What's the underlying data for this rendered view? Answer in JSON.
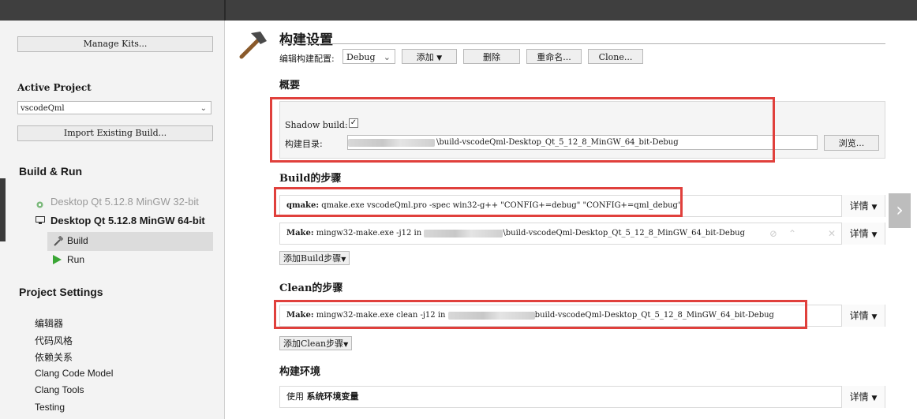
{
  "sidebar": {
    "manage_kits": "Manage Kits...",
    "active_project_label": "Active Project",
    "project_selected": "vscodeQml",
    "import_build": "Import Existing Build...",
    "build_run_label": "Build & Run",
    "kits": [
      {
        "label": "Desktop Qt 5.12.8 MinGW 32-bit"
      },
      {
        "label": "Desktop Qt 5.12.8 MinGW 64-bit"
      }
    ],
    "build_item": "Build",
    "run_item": "Run",
    "project_settings_label": "Project Settings",
    "settings_items": [
      "编辑器",
      "代码风格",
      "依赖关系",
      "Clang Code Model",
      "Clang Tools",
      "Testing"
    ]
  },
  "main": {
    "title": "构建设置",
    "edit_config_label": "编辑构建配置:",
    "config_selected": "Debug",
    "add_button": "添加",
    "delete_button": "删除",
    "rename_button": "重命名...",
    "clone_button": "Clone...",
    "overview_heading": "概要",
    "shadow_build_label": "Shadow build:",
    "build_dir_label": "构建目录:",
    "build_dir_value": "\\build-vscodeQml-Desktop_Qt_5_12_8_MinGW_64_bit-Debug",
    "browse_button": "浏览...",
    "build_steps_heading": "Build的步骤",
    "build_steps": [
      {
        "name": "qmake:",
        "command": "qmake.exe vscodeQml.pro -spec win32-g++ \"CONFIG+=debug\" \"CONFIG+=qml_debug\"",
        "details": "详情"
      },
      {
        "name": "Make:",
        "command": "mingw32-make.exe -j12 in",
        "path": "\\build-vscodeQml-Desktop_Qt_5_12_8_MinGW_64_bit-Debug",
        "details": "详情"
      }
    ],
    "add_build_step": "添加Build步骤",
    "clean_steps_heading": "Clean的步骤",
    "clean_steps": [
      {
        "name": "Make:",
        "command": "mingw32-make.exe clean -j12 in",
        "path": "build-vscodeQml-Desktop_Qt_5_12_8_MinGW_64_bit-Debug",
        "details": "详情"
      }
    ],
    "add_clean_step": "添加Clean步骤",
    "env_heading": "构建环境",
    "env_use": "使用",
    "env_value": "系统环境变量",
    "env_details": "详情"
  },
  "colors": {
    "highlight_box": "#e0403c",
    "topbar": "#3f3f3f",
    "sidebar_bg": "#f3f3f3"
  }
}
